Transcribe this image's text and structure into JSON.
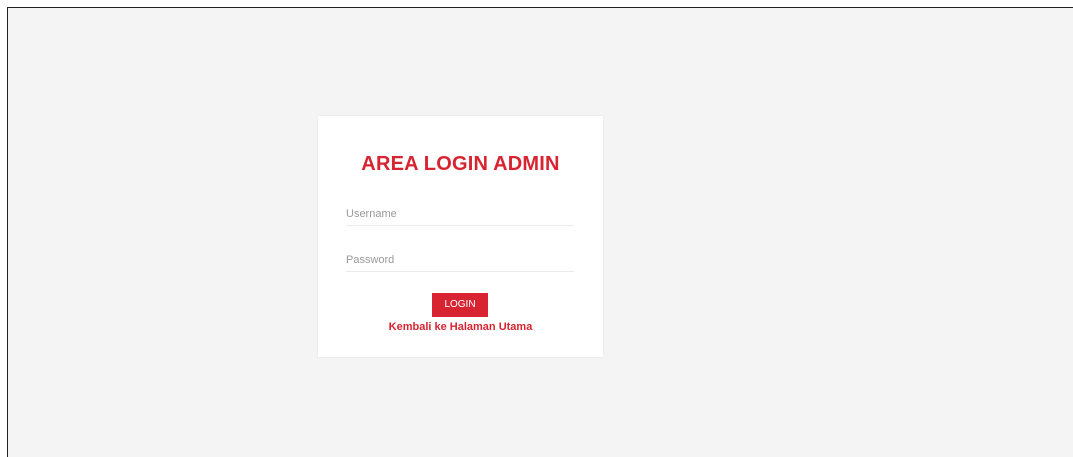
{
  "login": {
    "title": "AREA LOGIN ADMIN",
    "username_placeholder": "Username",
    "password_placeholder": "Password",
    "login_label": "LOGIN",
    "back_link_label": "Kembali ke Halaman Utama"
  },
  "colors": {
    "accent": "#d82430",
    "background": "#f4f4f4",
    "card": "#ffffff"
  }
}
